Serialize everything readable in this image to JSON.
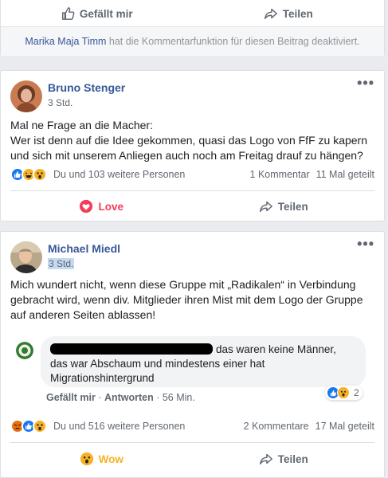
{
  "top_card": {
    "like_label": "Gefällt mir",
    "share_label": "Teilen",
    "notice_name": "Marika Maja Timm",
    "notice_text": " hat die Kommentarfunktion für diesen Beitrag deaktiviert."
  },
  "post1": {
    "author": "Bruno Stenger",
    "time": "3 Std.",
    "text_line1": "Mal ne Frage an die Macher:",
    "text_line2": "Wer ist denn auf die Idee gekommen, quasi das Logo von FfF zu kapern",
    "text_line3": "und sich mit unserem Anliegen auch noch am Freitag drauf zu hängen?",
    "reactions_text": "Du und 103 weitere Personen",
    "comments_count": "1 Kommentar",
    "shares_count": "11 Mal geteilt",
    "reaction_button": "Love",
    "share_label": "Teilen",
    "more": "•••"
  },
  "post2": {
    "author": "Michael Miedl",
    "time": "3 Std.",
    "text_line1": "Mich wundert nicht, wenn diese Gruppe mit „Radikalen“ in Verbindung",
    "text_line2": "gebracht wird, wenn div. Mitglieder ihren Mist mit dem Logo der Gruppe",
    "text_line3": "auf anderen Seiten ablassen!",
    "comment": {
      "text_line1": "das waren keine Männer,",
      "text_line2": "das war Abschaum und mindestens einer hat",
      "text_line3": "Migrationshintergrund",
      "like_label": "Gefällt mir",
      "sep1": " · ",
      "reply_label": "Antworten",
      "sep2": " · ",
      "time": "56 Min.",
      "reaction_count": "2"
    },
    "reactions_text": "Du und 516 weitere Personen",
    "comments_count": "2 Kommentare",
    "shares_count": "17 Mal geteilt",
    "reaction_button": "Wow",
    "share_label": "Teilen",
    "more": "•••"
  },
  "colors": {
    "link_blue": "#385898",
    "like_blue": "#1877f2",
    "love_red": "#f33e58",
    "wow_yellow": "#f7b125",
    "angry_orange": "#e9710f"
  }
}
